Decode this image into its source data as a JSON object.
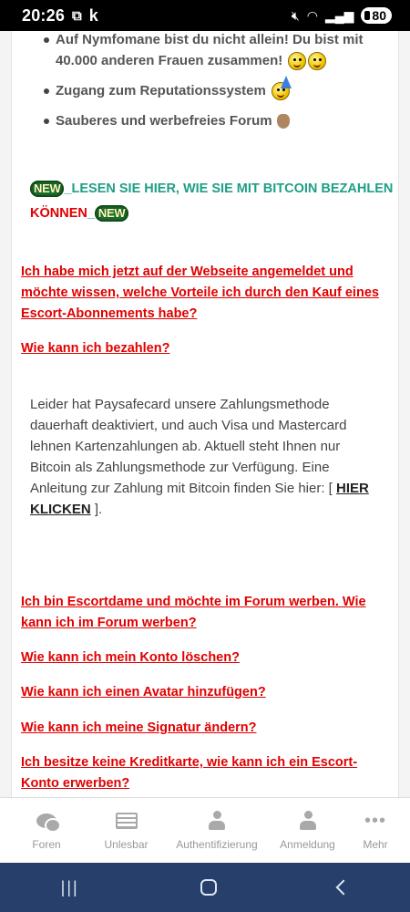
{
  "status": {
    "time": "20:26",
    "battery": "80"
  },
  "bullets": [
    "Auf Nymfomane bist du nicht allein! Du bist mit 40.000 anderen Frauen zusammen!",
    "Zugang zum Reputationssystem",
    "Sauberes und werbefreies Forum"
  ],
  "promo": {
    "badge": "NEW",
    "text_green": "_LESEN SIE HIER, WIE SIE MIT BITCOIN BEZAHLEN ",
    "text_red": "KÖNNEN",
    "underscore": "_"
  },
  "faq": [
    "Ich habe mich jetzt auf der Webseite angemeldet und möchte wissen, welche Vorteile ich durch den Kauf eines Escort-Abonnements habe?",
    "Wie kann ich bezahlen?",
    "Ich bin Escortdame und möchte im Forum werben. Wie kann ich im Forum werben?",
    "Wie kann ich mein Konto löschen?",
    "Wie kann ich einen Avatar hinzufügen?",
    "Wie kann ich meine Signatur ändern?",
    "Ich besitze keine Kreditkarte, wie kann ich ein Escort-Konto erwerben?"
  ],
  "answer": {
    "text": "Leider hat Paysafecard unsere Zahlungsmethode dauerhaft deaktiviert, und auch Visa und Mastercard lehnen Kartenzahlungen ab. Aktuell steht Ihnen nur Bitcoin als Zahlungsmethode zur Verfügung. Eine Anleitung zur Zahlung mit Bitcoin finden Sie hier: [ ",
    "link": "HIER KLICKEN",
    "tail": " ]."
  },
  "bottom_nav": [
    "Foren",
    "Unlesbar",
    "Authentifizierung",
    "Anmeldung",
    "Mehr"
  ],
  "icons": {
    "foren": "chat-bubbles-icon",
    "unlesbar": "newspaper-icon",
    "authentifizierung": "person-icon",
    "anmeldung": "person-icon",
    "mehr": "more-dots-icon"
  }
}
